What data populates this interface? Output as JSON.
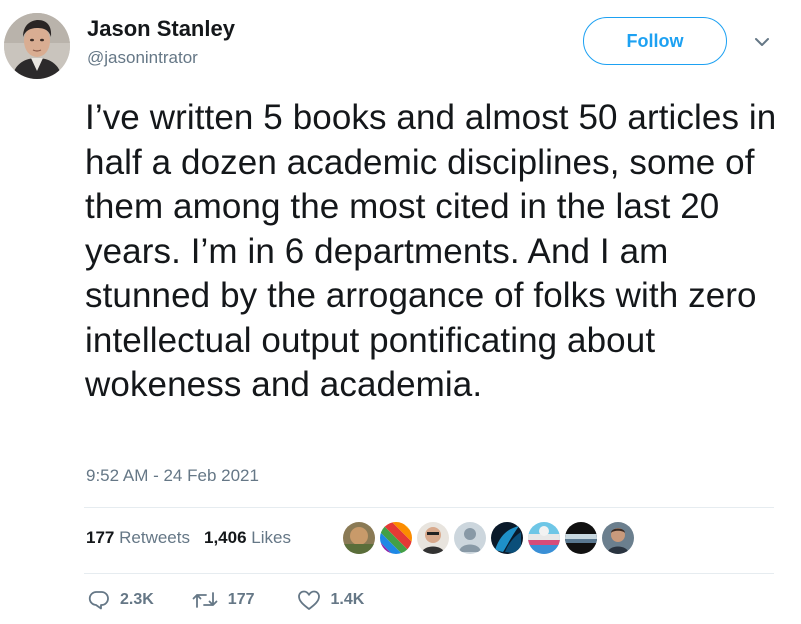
{
  "user": {
    "name": "Jason Stanley",
    "handle": "@jasonintrator"
  },
  "follow_label": "Follow",
  "tweet": {
    "text": "I’ve written 5 books and almost 50 articles in half a dozen academic disciplines, some of them among the most cited in the last 20 years. I’m in 6 departments. And I am stunned by the arrogance of folks with zero intellectual output pontificating about wokeness and academia.",
    "timestamp": "9:52 AM - 24 Feb 2021"
  },
  "stats": {
    "retweets_count": "177",
    "retweets_label": "Retweets",
    "likes_count": "1,406",
    "likes_label": "Likes"
  },
  "actions": {
    "replies": "2.3K",
    "retweets": "177",
    "likes": "1.4K"
  },
  "icons": {
    "caret": "chevron-down-icon",
    "reply": "reply-icon",
    "retweet": "retweet-icon",
    "like": "heart-icon"
  },
  "colors": {
    "accent": "#1da1f2",
    "text": "#14171a",
    "secondary": "#657786",
    "divider": "#e6ecf0"
  }
}
